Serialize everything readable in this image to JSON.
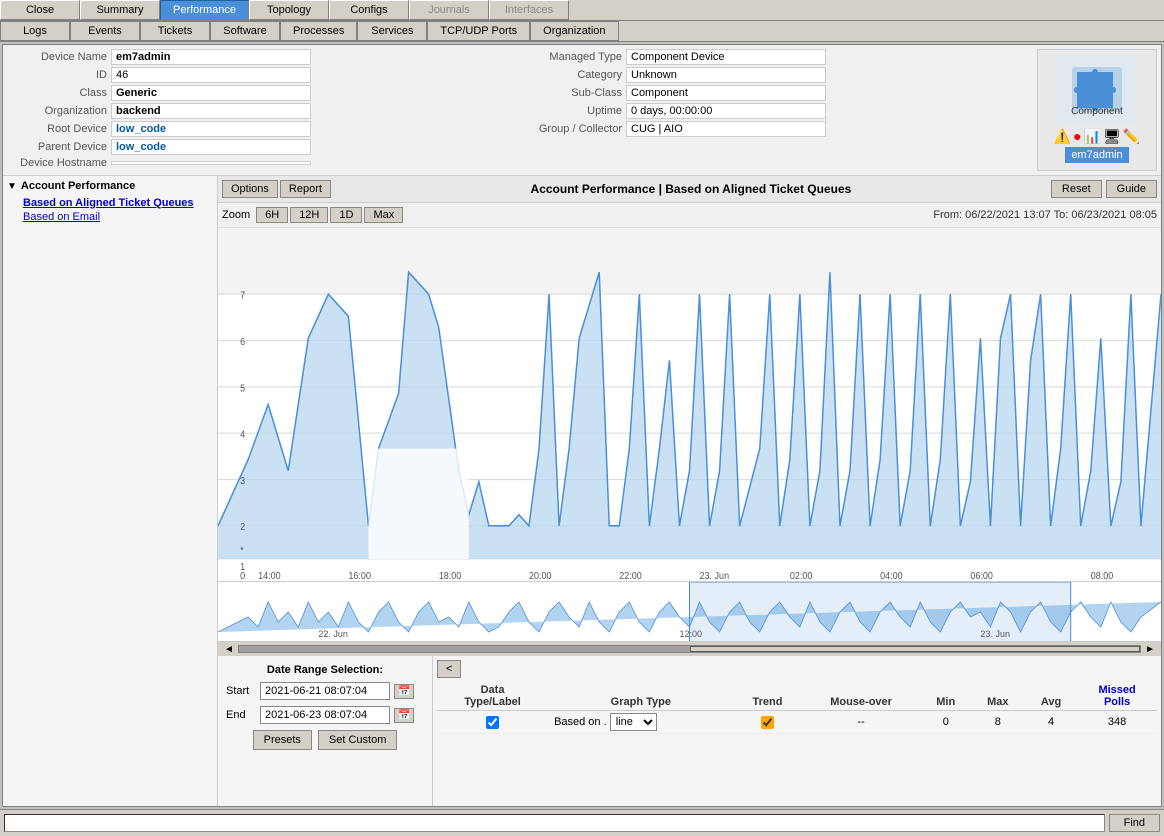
{
  "nav": {
    "top_tabs": [
      {
        "label": "Close",
        "active": false
      },
      {
        "label": "Summary",
        "active": false
      },
      {
        "label": "Performance",
        "active": true
      },
      {
        "label": "Topology",
        "active": false
      },
      {
        "label": "Configs",
        "active": false
      },
      {
        "label": "Journals",
        "active": false,
        "disabled": true
      },
      {
        "label": "Interfaces",
        "active": false,
        "disabled": true
      }
    ],
    "bottom_tabs": [
      {
        "label": "Logs",
        "active": false
      },
      {
        "label": "Events",
        "active": false
      },
      {
        "label": "Tickets",
        "active": false
      },
      {
        "label": "Software",
        "active": false,
        "disabled": true
      },
      {
        "label": "Processes",
        "active": false,
        "disabled": true
      },
      {
        "label": "Services",
        "active": false,
        "disabled": true
      },
      {
        "label": "TCP/UDP Ports",
        "active": false,
        "disabled": true
      },
      {
        "label": "Organization",
        "active": false
      }
    ]
  },
  "device": {
    "name_label": "Device Name",
    "name_value": "em7admin",
    "id_label": "ID",
    "id_value": "46",
    "class_label": "Class",
    "class_value": "Generic",
    "org_label": "Organization",
    "org_value": "backend",
    "root_label": "Root Device",
    "root_value": "low_code",
    "parent_label": "Parent Device",
    "parent_value": "low_code",
    "hostname_label": "Device Hostname",
    "hostname_value": "",
    "managed_label": "Managed Type",
    "managed_value": "Component Device",
    "category_label": "Category",
    "category_value": "Unknown",
    "subclass_label": "Sub-Class",
    "subclass_value": "Component",
    "uptime_label": "Uptime",
    "uptime_value": "0 days, 00:00:00",
    "group_label": "Group / Collector",
    "group_value": "CUG | AIO",
    "icon_label": "Component",
    "icon_badge": "em7admin"
  },
  "sidebar": {
    "header": "Account Performance",
    "items": [
      {
        "label": "Based on Aligned Ticket Queues",
        "active": true
      },
      {
        "label": "Based on Email",
        "active": false
      }
    ]
  },
  "chart": {
    "title": "Account Performance | Based on Aligned Ticket Queues",
    "options_btn": "Options",
    "report_btn": "Report",
    "reset_btn": "Reset",
    "guide_btn": "Guide",
    "zoom_label": "Zoom",
    "zoom_btns": [
      "6H",
      "12H",
      "1D",
      "Max"
    ],
    "from_label": "From:",
    "from_value": "06/22/2021 13:07",
    "to_label": "To:",
    "to_value": "06/23/2021 08:05",
    "x_labels": [
      "14:00",
      "16:00",
      "18:00",
      "20:00",
      "22:00",
      "23. Jun",
      "02:00",
      "04:00",
      "06:00",
      "08:00"
    ],
    "y_labels": [
      "0",
      "1",
      "*",
      "2",
      "3",
      "4",
      "5",
      "6",
      "7"
    ],
    "mini_labels": [
      "22. Jun",
      "12:00",
      "23. Jun"
    ],
    "nav_left": "<",
    "nav_right": ">"
  },
  "data_table": {
    "cols": [
      "Data Type/Label",
      "Graph Type",
      "Trend",
      "Mouse-over",
      "Min",
      "Max",
      "Avg",
      "Missed Polls"
    ],
    "rows": [
      {
        "checked": true,
        "label": "Based on .",
        "graph_type": "line",
        "trend_checked": true,
        "mouseover": "--",
        "min": "0",
        "max": "8",
        "avg": "4",
        "missed": "348"
      }
    ]
  },
  "date_panel": {
    "title": "Date Range Selection:",
    "start_label": "Start",
    "start_value": "2021-06-21 08:07:04",
    "end_label": "End",
    "end_value": "2021-06-23 08:07:04",
    "presets_btn": "Presets",
    "custom_btn": "Set Custom"
  },
  "search": {
    "placeholder": "",
    "find_btn": "Find"
  }
}
